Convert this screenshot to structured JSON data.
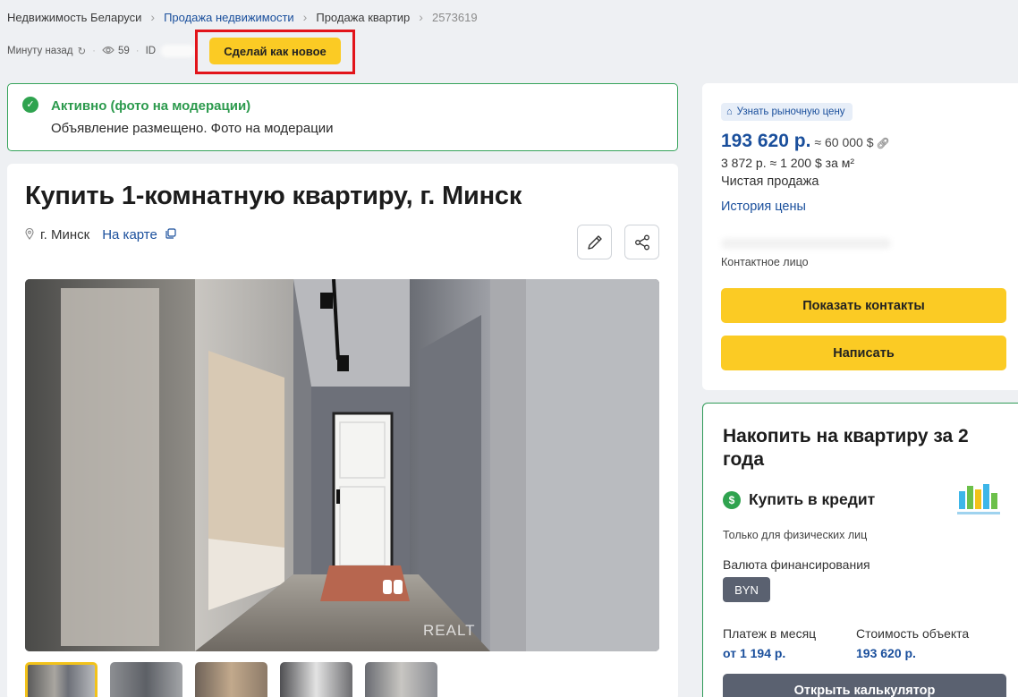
{
  "breadcrumbs": [
    {
      "label": "Недвижимость Беларуси",
      "style": "plain"
    },
    {
      "label": "Продажа недвижимости",
      "style": "link"
    },
    {
      "label": "Продажа квартир",
      "style": "plain"
    },
    {
      "label": "2573619",
      "style": "muted"
    }
  ],
  "meta": {
    "updated": "Минуту назад",
    "views": "59",
    "id_label": "ID",
    "renew_button": "Сделай как новое"
  },
  "status": {
    "title": "Активно (фото на модерации)",
    "description": "Объявление размещено. Фото на модерации"
  },
  "listing": {
    "title": "Купить 1-комнатную квартиру, г. Минск",
    "city": "г. Минск",
    "map_link": "На карте",
    "watermark": "REALT"
  },
  "price": {
    "market_button": "Узнать рыночную цену",
    "main": "193 620 р.",
    "usd": "≈ 60 000 $",
    "per_sqm": "3 872 р. ≈ 1 200 $ за м²",
    "sale_type": "Чистая продажа",
    "history_link": "История цены",
    "contact_label": "Контактное лицо",
    "show_contacts": "Показать контакты",
    "write": "Написать"
  },
  "credit": {
    "title": "Накопить на квартиру за 2 года",
    "buy": "Купить в кредит",
    "only_individuals": "Только для физических лиц",
    "currency_label": "Валюта финансирования",
    "currency_value": "BYN",
    "monthly_label": "Платеж в месяц",
    "monthly_value": "от 1 194 р.",
    "cost_label": "Стоимость объекта",
    "cost_value": "193 620 р.",
    "calc_button": "Открыть калькулятор"
  },
  "colors": {
    "accent_yellow": "#fbcb24",
    "link_blue": "#1a4f9c",
    "success_green": "#2fa34f",
    "highlight_red": "#e2141a"
  }
}
